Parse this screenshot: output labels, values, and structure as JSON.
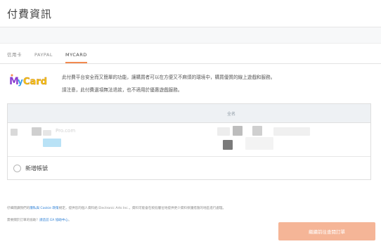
{
  "header": {
    "title": "付費資訊"
  },
  "tabs": [
    {
      "label": "信用卡"
    },
    {
      "label": "PAYPAL"
    },
    {
      "label": "MYCARD"
    }
  ],
  "mycard": {
    "logo_text": "MyCard",
    "description_line1": "此付費平台安全而又簡單的功能，讓購買者可以在方便又不麻煩的環境中，購買優質的線上遊戲和服務。",
    "description_line2": "請注意，此付費選項無法退款，也不適用於優惠遊戲服務。"
  },
  "accounts_table": {
    "column_header": "全名",
    "row_blurred_text": "Pro.com"
  },
  "add_account": {
    "label": "新增帳號"
  },
  "footer": {
    "line1_prefix": "仔細閱讀我們的",
    "privacy_link": "隱私與 Cookie 政策",
    "line1_suffix": "規定，提供您的個人資料給 Electronic Arts Inc.，資料可能會在較低層位地提供更少資料保護措施的地區進行處理。",
    "line2_prefix": "需要關於訂單的協助？",
    "help_link": "請造訪 EA 協助中心",
    "line2_suffix": "。"
  },
  "submit": {
    "label": "繼續前往查閱訂單"
  },
  "colors": {
    "accent_tab": "#f28a4f",
    "link": "#2d7fd5",
    "submit_button": "#f5b597",
    "logo_purple": "#8a3fd1",
    "logo_yellow": "#f5c518",
    "logo_blue": "#3aa0e8"
  }
}
